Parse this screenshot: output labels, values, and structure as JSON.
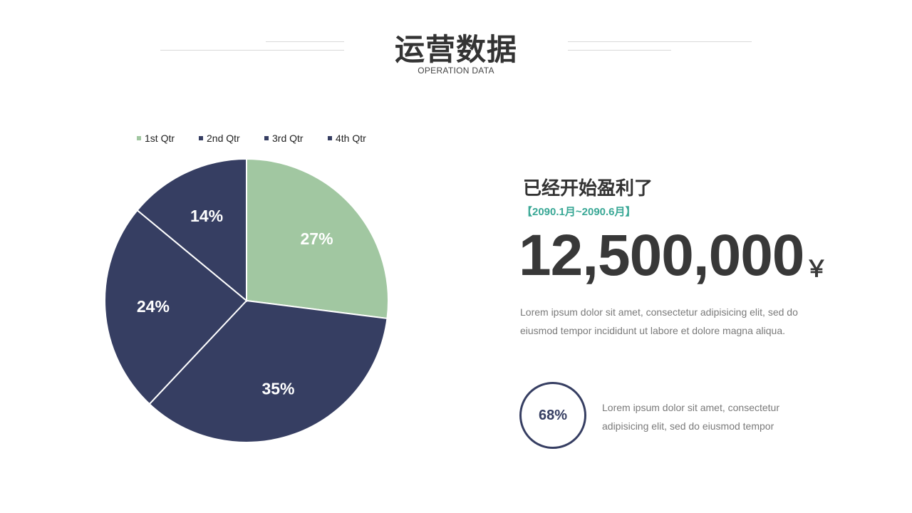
{
  "header": {
    "title": "运营数据",
    "subtitle": "OPERATION DATA"
  },
  "chart_data": {
    "type": "pie",
    "categories": [
      "1st Qtr",
      "2nd Qtr",
      "3rd Qtr",
      "4th Qtr"
    ],
    "values": [
      27,
      35,
      24,
      14
    ],
    "labels": [
      "27%",
      "35%",
      "24%",
      "14%"
    ],
    "colors": [
      "#a1c7a1",
      "#363e62",
      "#363e62",
      "#363e62"
    ],
    "legend_colors": [
      "#a1c7a1",
      "#363e62",
      "#363e62",
      "#363e62"
    ],
    "legend": "top"
  },
  "info": {
    "headline": "已经开始盈利了",
    "period": "【2090.1月~2090.6月】",
    "amount": "12,500,000",
    "currency": "￥",
    "description": "Lorem ipsum dolor sit amet, consectetur adipisicing elit, sed do eiusmod tempor incididunt ut labore et dolore magna aliqua.",
    "ring_percent": "68%",
    "ring_description": "Lorem ipsum dolor sit amet, consectetur adipisicing elit, sed do eiusmod tempor"
  },
  "colors": {
    "accent_green": "#a1c7a1",
    "navy": "#363e62",
    "teal_text": "#3aa896"
  }
}
